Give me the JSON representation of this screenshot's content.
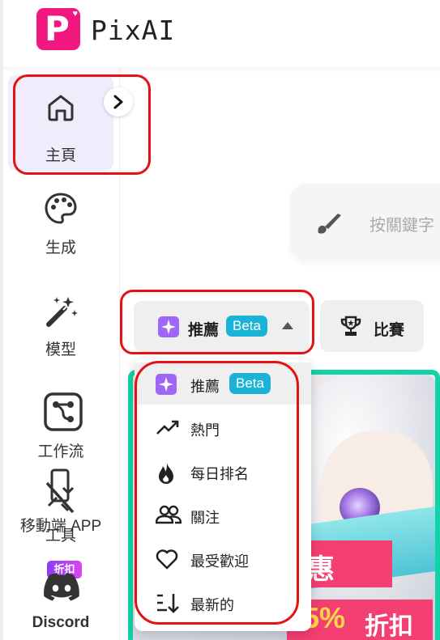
{
  "header": {
    "brand": "PixAI",
    "logo_icon": "pixai-logo-icon"
  },
  "sidebar": {
    "items": [
      {
        "label": "主頁",
        "icon": "home-icon",
        "active": true
      },
      {
        "label": "生成",
        "icon": "palette-icon"
      },
      {
        "label": "模型",
        "icon": "magic-wand-icon"
      },
      {
        "label": "工作流",
        "icon": "workflow-icon"
      },
      {
        "label": "工具",
        "icon": "tools-icon"
      },
      {
        "label": "移動端 APP",
        "icon": "mobile-icon"
      },
      {
        "label": "Discord",
        "icon": "discord-icon",
        "badge": "折扣"
      }
    ]
  },
  "search": {
    "placeholder": "按關鍵字"
  },
  "filter": {
    "label": "推薦",
    "badge": "Beta"
  },
  "contest": {
    "label": "比賽"
  },
  "dropdown": {
    "items": [
      {
        "label": "推薦",
        "badge": "Beta",
        "icon": "sparkle-icon",
        "selected": true
      },
      {
        "label": "熱門",
        "icon": "trending-icon"
      },
      {
        "label": "每日排名",
        "icon": "flame-icon"
      },
      {
        "label": "關注",
        "icon": "people-icon"
      },
      {
        "label": "最受歡迎",
        "icon": "heart-icon"
      },
      {
        "label": "最新的",
        "icon": "sort-newest-icon"
      }
    ]
  },
  "banner": {
    "promo_text": "惠",
    "discount_percent": "55%",
    "discount_text": "折扣"
  },
  "colors": {
    "accent": "#8b5cf6",
    "brand": "#f2177e",
    "beta": "#1ab3d6",
    "annotation": "#e41212",
    "banner_border": "#12d2a8"
  }
}
